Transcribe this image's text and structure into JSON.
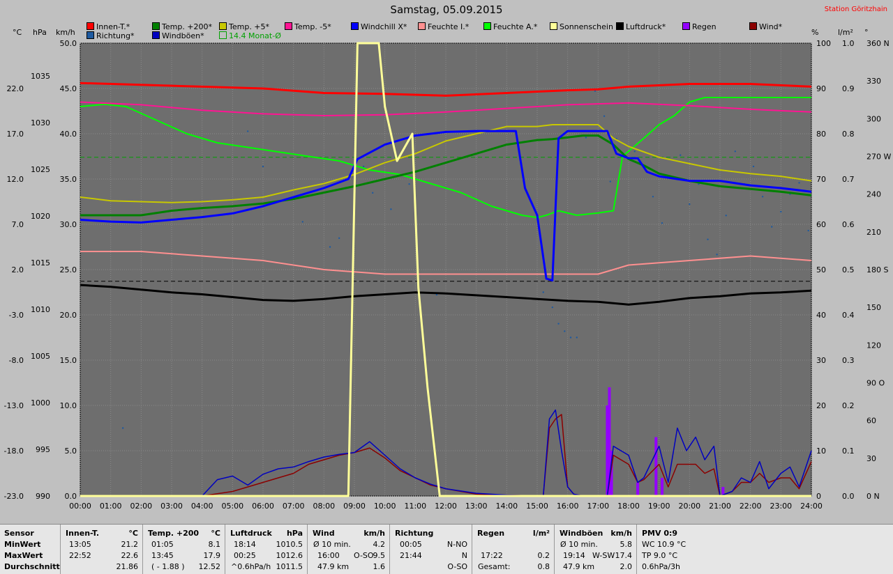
{
  "header": {
    "title": "Samstag, 05.09.2015",
    "station": "Station Göritzhain"
  },
  "legend": [
    {
      "label": "Innen-T.*",
      "color": "#ff0000"
    },
    {
      "label": "Temp. +200*",
      "color": "#008000"
    },
    {
      "label": "Temp. +5*",
      "color": "#c8c800"
    },
    {
      "label": "Temp. -5*",
      "color": "#ff1493"
    },
    {
      "label": "Windchill X*",
      "color": "#0000ff"
    },
    {
      "label": "Feuchte I.*",
      "color": "#ff9090"
    },
    {
      "label": "Feuchte A.*",
      "color": "#00ff00"
    },
    {
      "label": "Sonnenschein",
      "color": "#ffff99"
    },
    {
      "label": "Luftdruck*",
      "color": "#000000"
    },
    {
      "label": "Regen",
      "color": "#9400ff"
    },
    {
      "label": "Wind*",
      "color": "#8b0000"
    },
    {
      "label": "Richtung*",
      "color": "#1e5aa0"
    },
    {
      "label": "Windböen*",
      "color": "#0000c0"
    },
    {
      "label": "14.4 Monat-Ø",
      "color": "#00a000"
    }
  ],
  "units": {
    "celsius": "°C",
    "hpa": "hPa",
    "kmh": "km/h",
    "percent": "%",
    "lm2": "l/m²",
    "deg": "°"
  },
  "chart_data": {
    "type": "line",
    "x_ticks": [
      "00:00",
      "01:00",
      "02:00",
      "03:00",
      "04:00",
      "05:00",
      "06:00",
      "07:00",
      "08:00",
      "09:00",
      "10:00",
      "11:00",
      "12:00",
      "13:00",
      "14:00",
      "15:00",
      "16:00",
      "17:00",
      "18:00",
      "19:00",
      "20:00",
      "21:00",
      "22:00",
      "23:00",
      "24:00"
    ],
    "axes": {
      "temp_c": {
        "ticks": [
          "22.0",
          "17.0",
          "12.0",
          "7.0",
          "2.0",
          "-3.0",
          "-8.0",
          "-13.0",
          "-18.0",
          "-23.0"
        ],
        "range": [
          -23,
          27
        ]
      },
      "pressure_hpa": {
        "ticks": [
          "1035",
          "1030",
          "1025",
          "1020",
          "1015",
          "1010",
          "1005",
          "1000",
          "995",
          "990"
        ],
        "range": [
          990,
          1038.5
        ]
      },
      "wind_kmh": {
        "ticks": [
          "50.0",
          "45.0",
          "40.0",
          "35.0",
          "30.0",
          "25.0",
          "20.0",
          "15.0",
          "10.0",
          "5.0",
          "0.0"
        ],
        "range": [
          0,
          50
        ]
      },
      "humidity_pct": {
        "ticks": [
          "100",
          "90",
          "80",
          "70",
          "60",
          "50",
          "40",
          "30",
          "20",
          "10",
          "0"
        ],
        "range": [
          0,
          100
        ]
      },
      "rain_lm2": {
        "ticks": [
          "1.0",
          "0.9",
          "0.8",
          "0.7",
          "0.6",
          "0.5",
          "0.4",
          "0.3",
          "0.2",
          "0.1",
          "0.0"
        ],
        "range": [
          0,
          1
        ]
      },
      "direction_deg": {
        "ticks": [
          "360 N",
          "330",
          "300",
          "270 W",
          "240",
          "210",
          "180 S",
          "150",
          "120",
          "90 O",
          "60",
          "30",
          "0 N"
        ],
        "range": [
          0,
          360
        ]
      }
    },
    "ref_lines": [
      {
        "name": "14.4 Monat-Ø",
        "axis": "temp_c",
        "value": 14.4,
        "color": "#00a000"
      },
      {
        "name": "black-dashed",
        "axis": "pressure_hpa",
        "value": 1013.0,
        "color": "#000000"
      }
    ],
    "series": [
      {
        "name": "Innen-T.*",
        "axis": "temp_c",
        "color": "#ff0000",
        "width": 3,
        "x": [
          0,
          2,
          4,
          6,
          8,
          10,
          12,
          14,
          16,
          17,
          18,
          20,
          22,
          24
        ],
        "y": [
          22.6,
          22.4,
          22.2,
          22.0,
          21.5,
          21.4,
          21.2,
          21.5,
          21.8,
          21.9,
          22.2,
          22.5,
          22.5,
          22.2
        ]
      },
      {
        "name": "Temp. -5*",
        "axis": "temp_c",
        "color": "#ff1493",
        "width": 2,
        "x": [
          0,
          2,
          4,
          6,
          8,
          10,
          12,
          14,
          16,
          18,
          20,
          22,
          24
        ],
        "y": [
          20.5,
          20.2,
          19.6,
          19.2,
          19.0,
          19.1,
          19.4,
          19.8,
          20.2,
          20.4,
          20.1,
          19.7,
          19.4
        ]
      },
      {
        "name": "Temp. +5*",
        "axis": "temp_c",
        "color": "#c8c800",
        "width": 2,
        "x": [
          0,
          1,
          2,
          3,
          4,
          5,
          6,
          7,
          8,
          9,
          10,
          11,
          12,
          13,
          14,
          15,
          15.5,
          16,
          16.5,
          17,
          17.5,
          18,
          18.5,
          19,
          20,
          21,
          22,
          23,
          24
        ],
        "y": [
          10.0,
          9.6,
          9.5,
          9.4,
          9.5,
          9.7,
          10.0,
          10.8,
          11.5,
          12.5,
          13.8,
          14.8,
          16.2,
          17.0,
          17.8,
          17.8,
          18.0,
          18.0,
          18.0,
          18.0,
          16.5,
          15.6,
          15.0,
          14.4,
          13.7,
          13.0,
          12.6,
          12.3,
          11.8
        ]
      },
      {
        "name": "Temp. +200*",
        "axis": "temp_c",
        "color": "#008000",
        "width": 3,
        "x": [
          0,
          1,
          2,
          3,
          4,
          5,
          6,
          7,
          8,
          9,
          10,
          11,
          12,
          13,
          14,
          15,
          15.5,
          16,
          16.5,
          17,
          17.5,
          18,
          18.5,
          19,
          20,
          21,
          22,
          23,
          24
        ],
        "y": [
          8.0,
          8.0,
          8.0,
          8.5,
          8.8,
          9.0,
          9.3,
          9.8,
          10.5,
          11.2,
          12.0,
          12.8,
          13.8,
          14.8,
          15.8,
          16.3,
          16.4,
          16.6,
          16.8,
          16.8,
          15.8,
          14.2,
          13.5,
          12.6,
          11.8,
          11.2,
          10.9,
          10.6,
          10.2
        ]
      },
      {
        "name": "Windchill X*",
        "axis": "temp_c",
        "color": "#0000ff",
        "width": 3,
        "x": [
          0,
          1,
          2,
          3,
          4,
          5,
          6,
          7,
          8,
          8.8,
          9.1,
          10,
          11,
          12,
          13,
          14,
          14.3,
          14.6,
          15,
          15.3,
          15.5,
          15.7,
          16,
          16.8,
          17.3,
          17.6,
          18,
          18.3,
          18.6,
          19,
          20,
          21,
          22,
          23,
          24
        ],
        "y": [
          7.5,
          7.3,
          7.2,
          7.5,
          7.8,
          8.2,
          9.0,
          10.0,
          11.0,
          12.0,
          14.2,
          15.8,
          16.8,
          17.2,
          17.3,
          17.3,
          17.3,
          11.0,
          8.0,
          1.0,
          0.8,
          16.5,
          17.3,
          17.3,
          17.3,
          14.8,
          14.3,
          14.3,
          12.8,
          12.3,
          11.8,
          11.8,
          11.3,
          11.0,
          10.6
        ]
      },
      {
        "name": "Feuchte A.*",
        "axis": "humidity_pct",
        "color": "#00ff00",
        "width": 2,
        "x": [
          0,
          0.8,
          1.5,
          2.5,
          3.5,
          4.5,
          5.5,
          6.5,
          7.5,
          8.5,
          9.5,
          10.5,
          11.5,
          12.5,
          13.5,
          14.5,
          15,
          15.3,
          15.7,
          16.3,
          17,
          17.5,
          17.8,
          18.5,
          19,
          19.5,
          20,
          20.5,
          21,
          22,
          23,
          24
        ],
        "y": [
          86,
          86.5,
          86,
          83,
          80,
          78,
          77,
          76,
          75,
          74,
          72,
          71,
          69,
          67,
          64,
          62,
          61.5,
          62,
          63,
          62,
          62.5,
          63,
          75,
          79,
          82,
          84,
          87,
          88,
          88,
          88,
          88,
          88
        ]
      },
      {
        "name": "Feuchte I.*",
        "axis": "humidity_pct",
        "color": "#ff9090",
        "width": 2,
        "x": [
          0,
          2,
          4,
          6,
          8,
          10,
          12,
          14,
          15,
          16,
          17,
          18,
          20,
          22,
          24
        ],
        "y": [
          54,
          54,
          53,
          52,
          50,
          49,
          49,
          49,
          49,
          49,
          49,
          51,
          52,
          53,
          52
        ]
      },
      {
        "name": "Luftdruck*",
        "axis": "pressure_hpa",
        "color": "#000000",
        "width": 3,
        "x": [
          0,
          1,
          2,
          3,
          4,
          5,
          6,
          7,
          8,
          9,
          10,
          11,
          12,
          13,
          14,
          15,
          16,
          17,
          18,
          19,
          20,
          21,
          22,
          23,
          24
        ],
        "y": [
          1012.6,
          1012.4,
          1012.1,
          1011.8,
          1011.6,
          1011.3,
          1011.0,
          1010.9,
          1011.1,
          1011.4,
          1011.6,
          1011.8,
          1011.7,
          1011.5,
          1011.3,
          1011.1,
          1010.9,
          1010.8,
          1010.5,
          1010.8,
          1011.2,
          1011.4,
          1011.7,
          1011.8,
          1012.0
        ]
      },
      {
        "name": "Sonnenschein",
        "axis": "wind_kmh",
        "color": "#ffff99",
        "width": 3,
        "x": [
          0,
          8.8,
          9.1,
          9.8,
          10.0,
          10.4,
          10.9,
          11.1,
          11.4,
          11.8,
          12.0,
          24
        ],
        "y": [
          0,
          0,
          50,
          50,
          43,
          37,
          40,
          23,
          12,
          0,
          0,
          0
        ]
      },
      {
        "name": "Windböen*",
        "axis": "wind_kmh",
        "color": "#0000c0",
        "width": 1.5,
        "x": [
          0,
          4,
          4.5,
          5,
          5.5,
          6,
          6.5,
          7,
          7.5,
          8,
          8.5,
          9,
          9.5,
          10,
          10.5,
          11,
          11.5,
          12,
          13,
          14,
          15.2,
          15.4,
          15.6,
          15.8,
          16,
          16.2,
          16.5,
          17.3,
          17.5,
          18,
          18.3,
          18.5,
          19,
          19.3,
          19.6,
          19.9,
          20.2,
          20.5,
          20.8,
          21.0,
          21.4,
          21.7,
          22,
          22.3,
          22.6,
          23,
          23.3,
          23.6,
          24
        ],
        "y": [
          0,
          0,
          1.8,
          2.2,
          1.2,
          2.4,
          3.0,
          3.2,
          3.8,
          4.3,
          4.6,
          4.8,
          6.0,
          4.5,
          3.0,
          2.0,
          1.3,
          0.8,
          0.3,
          0.1,
          0,
          8.5,
          9.5,
          5.0,
          1.0,
          0.2,
          0,
          0,
          5.5,
          4.5,
          1.5,
          2.0,
          5.5,
          1.5,
          7.5,
          5.0,
          6.5,
          4.0,
          5.5,
          0,
          0.5,
          2.0,
          1.5,
          3.8,
          0.8,
          2.5,
          3.2,
          1.0,
          5.0
        ]
      },
      {
        "name": "Wind*",
        "axis": "wind_kmh",
        "color": "#8b0000",
        "width": 1.5,
        "x": [
          0,
          2,
          4,
          5,
          5.5,
          6,
          6.5,
          7,
          7.5,
          8,
          8.5,
          9,
          9.5,
          10,
          10.5,
          11,
          11.5,
          12,
          13,
          14,
          15.2,
          15.4,
          15.6,
          15.8,
          16,
          16.2,
          16.5,
          17.3,
          17.5,
          18,
          18.3,
          18.5,
          19,
          19.3,
          19.6,
          19.9,
          20.2,
          20.5,
          20.8,
          21.0,
          21.4,
          21.7,
          22,
          22.3,
          22.6,
          23,
          23.3,
          23.6,
          24
        ],
        "y": [
          0,
          0,
          0,
          0.5,
          1.0,
          1.5,
          2.0,
          2.5,
          3.5,
          4.0,
          4.5,
          4.8,
          5.3,
          4.2,
          2.8,
          2.0,
          1.2,
          0.8,
          0.2,
          0.1,
          0,
          7.5,
          8.5,
          9.0,
          1.0,
          0.2,
          0,
          0,
          4.5,
          3.5,
          1.5,
          1.8,
          3.5,
          1.0,
          3.5,
          3.5,
          3.5,
          2.5,
          3.0,
          0,
          0.5,
          1.5,
          1.5,
          2.5,
          1.5,
          2.0,
          2.0,
          0.8,
          3.8
        ]
      },
      {
        "name": "Regen",
        "axis": "rain_lm2",
        "color": "#9400ff",
        "type": "bar",
        "x": [
          17.3,
          17.37,
          17.44,
          18.3,
          18.9,
          19.1,
          21.1
        ],
        "y": [
          0.2,
          0.24,
          0.1,
          0.03,
          0.13,
          0.04,
          0.02
        ]
      }
    ],
    "direction_points": {
      "x": [
        1.4,
        5.5,
        6.0,
        7.3,
        8.2,
        8.5,
        9.0,
        9.3,
        9.6,
        10.2,
        10.8,
        11.7,
        15.2,
        15.5,
        15.7,
        15.9,
        16.1,
        16.3,
        16.6,
        16.9,
        17.2,
        17.4,
        17.6,
        17.9,
        18.2,
        18.5,
        18.8,
        19.1,
        19.4,
        19.7,
        20.0,
        20.3,
        20.6,
        20.9,
        21.2,
        21.5,
        21.8,
        22.1,
        22.4,
        22.7,
        23.0,
        23.3,
        23.6,
        23.9
      ],
      "y": [
        54,
        290,
        262,
        218,
        198,
        205,
        240,
        262,
        241,
        228,
        248,
        160,
        162,
        150,
        137,
        131,
        126,
        126,
        285,
        322,
        302,
        250,
        284,
        270,
        274,
        262,
        238,
        217,
        253,
        271,
        232,
        248,
        204,
        192,
        223,
        274,
        248,
        262,
        238,
        214,
        226,
        240,
        249,
        211
      ]
    },
    "direction_color": "#1e5aa0"
  },
  "stats": {
    "sensor": {
      "title": "Sensor",
      "rows": [
        "MinWert",
        "MaxWert",
        "Durchschnitt"
      ]
    },
    "innen": {
      "title": "Innen-T.",
      "unit": "°C",
      "rows": [
        [
          "13:05",
          "21.2"
        ],
        [
          "22:52",
          "22.6"
        ],
        [
          "",
          "21.86"
        ]
      ]
    },
    "temp200": {
      "title": "Temp. +200",
      "unit": "°C",
      "rows": [
        [
          "01:05",
          "8.1"
        ],
        [
          "13:45",
          "17.9"
        ],
        [
          "( - 1.88 )",
          "12.52"
        ]
      ]
    },
    "luftdruck": {
      "title": "Luftdruck",
      "unit": "hPa",
      "rows": [
        [
          "18:14",
          "1010.5"
        ],
        [
          "00:25",
          "1012.6"
        ],
        [
          "^0.6hPa/h",
          "1011.5"
        ]
      ]
    },
    "wind": {
      "title": "Wind",
      "unit": "km/h",
      "rows": [
        [
          "Ø 10 min.",
          "",
          "4.2"
        ],
        [
          "16:00",
          "O-SO",
          "9.5"
        ],
        [
          "47.9 km",
          "",
          "1.6"
        ]
      ]
    },
    "richtung": {
      "title": "Richtung",
      "rows": [
        [
          "00:05",
          "N-NO"
        ],
        [
          "21:44",
          "N"
        ],
        [
          "",
          "O-SO"
        ]
      ]
    },
    "regen": {
      "title": "Regen",
      "unit": "l/m²",
      "rows": [
        [
          "",
          ""
        ],
        [
          "17:22",
          "0.2"
        ],
        [
          "Gesamt:",
          "0.8"
        ]
      ]
    },
    "boeen": {
      "title": "Windböen",
      "unit": "km/h",
      "rows": [
        [
          "Ø 10 min.",
          "",
          "5.8"
        ],
        [
          "19:14",
          "W-SW",
          "17.4"
        ],
        [
          "47.9 km",
          "",
          "2.0"
        ]
      ]
    },
    "pmv": {
      "title": "PMV 0:9",
      "rows": [
        "WC 10.9 °C",
        "TP 9.0 °C",
        "0.6hPa/3h"
      ]
    }
  }
}
